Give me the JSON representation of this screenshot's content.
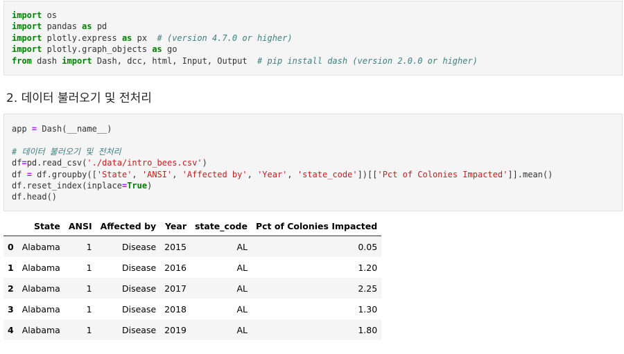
{
  "cell1": {
    "lines": [
      [
        {
          "t": "import",
          "c": "kw"
        },
        {
          "t": " os"
        }
      ],
      [
        {
          "t": "import",
          "c": "kw"
        },
        {
          "t": " pandas "
        },
        {
          "t": "as",
          "c": "kw"
        },
        {
          "t": " pd"
        }
      ],
      [
        {
          "t": "import",
          "c": "kw"
        },
        {
          "t": " plotly.express "
        },
        {
          "t": "as",
          "c": "kw"
        },
        {
          "t": " px  "
        },
        {
          "t": "# (version 4.7.0 or higher)",
          "c": "cm"
        }
      ],
      [
        {
          "t": "import",
          "c": "kw"
        },
        {
          "t": " plotly.graph_objects "
        },
        {
          "t": "as",
          "c": "kw"
        },
        {
          "t": " go"
        }
      ],
      [
        {
          "t": "from",
          "c": "kw"
        },
        {
          "t": " dash "
        },
        {
          "t": "import",
          "c": "kw"
        },
        {
          "t": " Dash, dcc, html, Input, Output  "
        },
        {
          "t": "# pip install dash (version 2.0.0 or higher)",
          "c": "cm"
        }
      ]
    ]
  },
  "heading": "2. 데이터 불러오기 및 전처리",
  "cell2": {
    "lines": [
      [
        {
          "t": "app "
        },
        {
          "t": "=",
          "c": "op"
        },
        {
          "t": " Dash(__name__)"
        }
      ],
      [
        {
          "t": ""
        }
      ],
      [
        {
          "t": "# 데이터 불러오기 및 전처리",
          "c": "cm"
        }
      ],
      [
        {
          "t": "df"
        },
        {
          "t": "=",
          "c": "op"
        },
        {
          "t": "pd.read_csv("
        },
        {
          "t": "'./data/intro_bees.csv'",
          "c": "str"
        },
        {
          "t": ")"
        }
      ],
      [
        {
          "t": "df "
        },
        {
          "t": "=",
          "c": "op"
        },
        {
          "t": " df.groupby(["
        },
        {
          "t": "'State'",
          "c": "str"
        },
        {
          "t": ", "
        },
        {
          "t": "'ANSI'",
          "c": "str"
        },
        {
          "t": ", "
        },
        {
          "t": "'Affected by'",
          "c": "str"
        },
        {
          "t": ", "
        },
        {
          "t": "'Year'",
          "c": "str"
        },
        {
          "t": ", "
        },
        {
          "t": "'state_code'",
          "c": "str"
        },
        {
          "t": "])[["
        },
        {
          "t": "'Pct of Colonies Impacted'",
          "c": "str"
        },
        {
          "t": "]].mean()"
        }
      ],
      [
        {
          "t": "df.reset_index(inplace"
        },
        {
          "t": "=",
          "c": "op"
        },
        {
          "t": "True",
          "c": "kw"
        },
        {
          "t": ")"
        }
      ],
      [
        {
          "t": "df.head()"
        }
      ]
    ]
  },
  "table": {
    "columns": [
      "State",
      "ANSI",
      "Affected by",
      "Year",
      "state_code",
      "Pct of Colonies Impacted"
    ],
    "rows": [
      {
        "index": "0",
        "cells": [
          "Alabama",
          "1",
          "Disease",
          "2015",
          "AL",
          "0.05"
        ]
      },
      {
        "index": "1",
        "cells": [
          "Alabama",
          "1",
          "Disease",
          "2016",
          "AL",
          "1.20"
        ]
      },
      {
        "index": "2",
        "cells": [
          "Alabama",
          "1",
          "Disease",
          "2017",
          "AL",
          "2.25"
        ]
      },
      {
        "index": "3",
        "cells": [
          "Alabama",
          "1",
          "Disease",
          "2018",
          "AL",
          "1.30"
        ]
      },
      {
        "index": "4",
        "cells": [
          "Alabama",
          "1",
          "Disease",
          "2019",
          "AL",
          "1.80"
        ]
      }
    ]
  }
}
